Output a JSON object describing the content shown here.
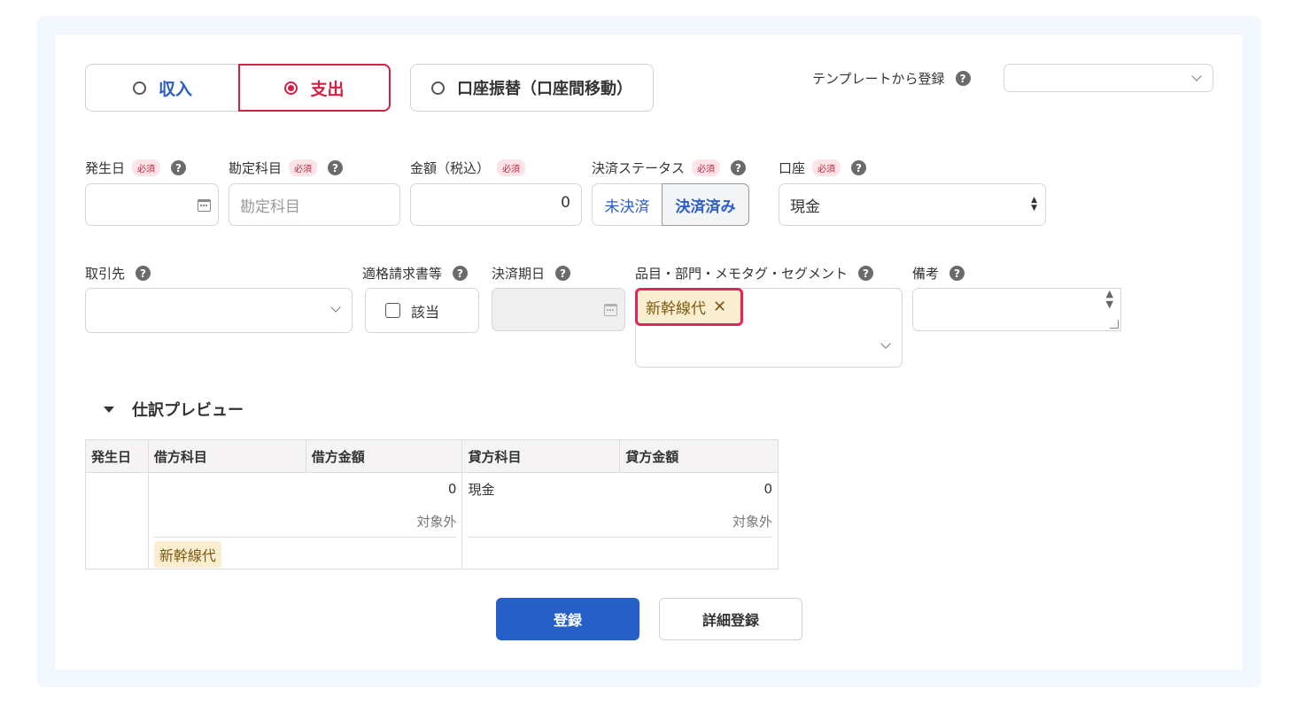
{
  "type_toggle": {
    "income_label": "収入",
    "expense_label": "支出",
    "transfer_label": "口座振替（口座間移動）",
    "selected": "expense"
  },
  "template": {
    "label": "テンプレートから登録",
    "value": ""
  },
  "required_badge": "必須",
  "fields": {
    "date": {
      "label": "発生日",
      "value": ""
    },
    "account": {
      "label": "勘定科目",
      "placeholder": "勘定科目"
    },
    "amount": {
      "label": "金額（税込）",
      "value": "0"
    },
    "payment_status": {
      "label": "決済ステータス",
      "option_unpaid": "未決済",
      "option_paid": "決済済み",
      "selected": "paid"
    },
    "wallet": {
      "label": "口座",
      "value": "現金"
    },
    "partner": {
      "label": "取引先",
      "value": ""
    },
    "invoice": {
      "label": "適格請求書等",
      "checkbox_label": "該当",
      "checked": false
    },
    "due_date": {
      "label": "決済期日",
      "value": ""
    },
    "tags": {
      "label": "品目・部門・メモタグ・セグメント",
      "selected": [
        "新幹線代"
      ]
    },
    "memo": {
      "label": "備考",
      "value": ""
    }
  },
  "preview": {
    "title": "仕訳プレビュー",
    "headers": [
      "発生日",
      "借方科目",
      "借方金額",
      "貸方科目",
      "貸方金額"
    ],
    "debit_amount": "0",
    "debit_tax": "対象外",
    "credit_account": "現金",
    "credit_amount": "0",
    "credit_tax": "対象外",
    "tag": "新幹線代"
  },
  "buttons": {
    "register": "登録",
    "detail_register": "詳細登録"
  },
  "colors": {
    "accent_blue": "#2460c8",
    "expense_red": "#d42043",
    "tag_highlight": "#e8225c"
  }
}
